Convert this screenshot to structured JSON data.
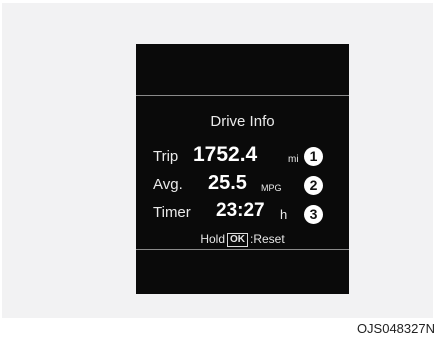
{
  "display": {
    "title": "Drive Info",
    "trip": {
      "label": "Trip",
      "value": "1752.4",
      "unit": "mi",
      "marker": "1"
    },
    "avg": {
      "label": "Avg.",
      "value": "25.5",
      "unit": "MPG",
      "marker": "2"
    },
    "timer": {
      "label": "Timer",
      "value": "23:27",
      "unit": "h",
      "marker": "3"
    },
    "hint": {
      "prefix": "Hold",
      "button": "OK",
      "suffix": ":Reset"
    }
  },
  "caption": {
    "code": "OJS048327N"
  }
}
